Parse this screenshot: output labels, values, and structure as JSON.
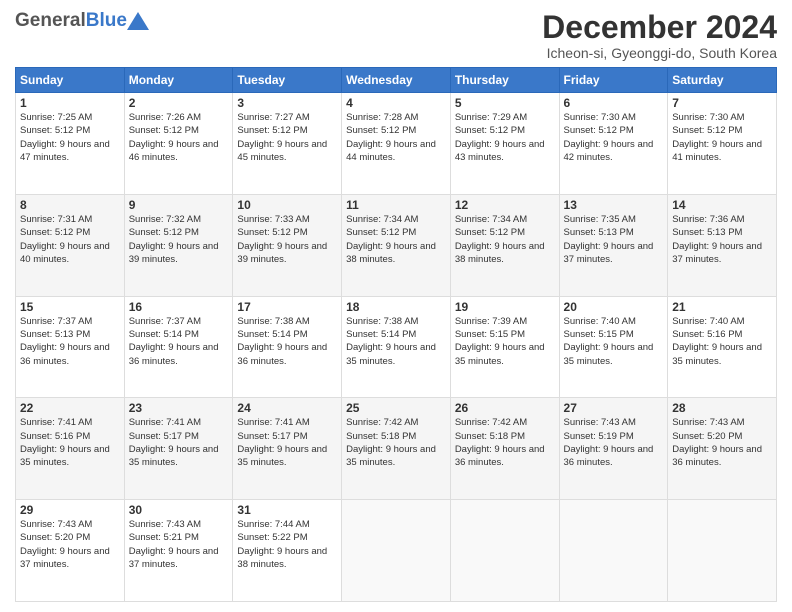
{
  "header": {
    "logo_general": "General",
    "logo_blue": "Blue",
    "month_title": "December 2024",
    "location": "Icheon-si, Gyeonggi-do, South Korea"
  },
  "days_of_week": [
    "Sunday",
    "Monday",
    "Tuesday",
    "Wednesday",
    "Thursday",
    "Friday",
    "Saturday"
  ],
  "weeks": [
    [
      {
        "day": "1",
        "sunrise": "7:25 AM",
        "sunset": "5:12 PM",
        "daylight": "9 hours and 47 minutes."
      },
      {
        "day": "2",
        "sunrise": "7:26 AM",
        "sunset": "5:12 PM",
        "daylight": "9 hours and 46 minutes."
      },
      {
        "day": "3",
        "sunrise": "7:27 AM",
        "sunset": "5:12 PM",
        "daylight": "9 hours and 45 minutes."
      },
      {
        "day": "4",
        "sunrise": "7:28 AM",
        "sunset": "5:12 PM",
        "daylight": "9 hours and 44 minutes."
      },
      {
        "day": "5",
        "sunrise": "7:29 AM",
        "sunset": "5:12 PM",
        "daylight": "9 hours and 43 minutes."
      },
      {
        "day": "6",
        "sunrise": "7:30 AM",
        "sunset": "5:12 PM",
        "daylight": "9 hours and 42 minutes."
      },
      {
        "day": "7",
        "sunrise": "7:30 AM",
        "sunset": "5:12 PM",
        "daylight": "9 hours and 41 minutes."
      }
    ],
    [
      {
        "day": "8",
        "sunrise": "7:31 AM",
        "sunset": "5:12 PM",
        "daylight": "9 hours and 40 minutes."
      },
      {
        "day": "9",
        "sunrise": "7:32 AM",
        "sunset": "5:12 PM",
        "daylight": "9 hours and 39 minutes."
      },
      {
        "day": "10",
        "sunrise": "7:33 AM",
        "sunset": "5:12 PM",
        "daylight": "9 hours and 39 minutes."
      },
      {
        "day": "11",
        "sunrise": "7:34 AM",
        "sunset": "5:12 PM",
        "daylight": "9 hours and 38 minutes."
      },
      {
        "day": "12",
        "sunrise": "7:34 AM",
        "sunset": "5:12 PM",
        "daylight": "9 hours and 38 minutes."
      },
      {
        "day": "13",
        "sunrise": "7:35 AM",
        "sunset": "5:13 PM",
        "daylight": "9 hours and 37 minutes."
      },
      {
        "day": "14",
        "sunrise": "7:36 AM",
        "sunset": "5:13 PM",
        "daylight": "9 hours and 37 minutes."
      }
    ],
    [
      {
        "day": "15",
        "sunrise": "7:37 AM",
        "sunset": "5:13 PM",
        "daylight": "9 hours and 36 minutes."
      },
      {
        "day": "16",
        "sunrise": "7:37 AM",
        "sunset": "5:14 PM",
        "daylight": "9 hours and 36 minutes."
      },
      {
        "day": "17",
        "sunrise": "7:38 AM",
        "sunset": "5:14 PM",
        "daylight": "9 hours and 36 minutes."
      },
      {
        "day": "18",
        "sunrise": "7:38 AM",
        "sunset": "5:14 PM",
        "daylight": "9 hours and 35 minutes."
      },
      {
        "day": "19",
        "sunrise": "7:39 AM",
        "sunset": "5:15 PM",
        "daylight": "9 hours and 35 minutes."
      },
      {
        "day": "20",
        "sunrise": "7:40 AM",
        "sunset": "5:15 PM",
        "daylight": "9 hours and 35 minutes."
      },
      {
        "day": "21",
        "sunrise": "7:40 AM",
        "sunset": "5:16 PM",
        "daylight": "9 hours and 35 minutes."
      }
    ],
    [
      {
        "day": "22",
        "sunrise": "7:41 AM",
        "sunset": "5:16 PM",
        "daylight": "9 hours and 35 minutes."
      },
      {
        "day": "23",
        "sunrise": "7:41 AM",
        "sunset": "5:17 PM",
        "daylight": "9 hours and 35 minutes."
      },
      {
        "day": "24",
        "sunrise": "7:41 AM",
        "sunset": "5:17 PM",
        "daylight": "9 hours and 35 minutes."
      },
      {
        "day": "25",
        "sunrise": "7:42 AM",
        "sunset": "5:18 PM",
        "daylight": "9 hours and 35 minutes."
      },
      {
        "day": "26",
        "sunrise": "7:42 AM",
        "sunset": "5:18 PM",
        "daylight": "9 hours and 36 minutes."
      },
      {
        "day": "27",
        "sunrise": "7:43 AM",
        "sunset": "5:19 PM",
        "daylight": "9 hours and 36 minutes."
      },
      {
        "day": "28",
        "sunrise": "7:43 AM",
        "sunset": "5:20 PM",
        "daylight": "9 hours and 36 minutes."
      }
    ],
    [
      {
        "day": "29",
        "sunrise": "7:43 AM",
        "sunset": "5:20 PM",
        "daylight": "9 hours and 37 minutes."
      },
      {
        "day": "30",
        "sunrise": "7:43 AM",
        "sunset": "5:21 PM",
        "daylight": "9 hours and 37 minutes."
      },
      {
        "day": "31",
        "sunrise": "7:44 AM",
        "sunset": "5:22 PM",
        "daylight": "9 hours and 38 minutes."
      },
      null,
      null,
      null,
      null
    ]
  ],
  "labels": {
    "sunrise": "Sunrise:",
    "sunset": "Sunset:",
    "daylight": "Daylight:"
  }
}
